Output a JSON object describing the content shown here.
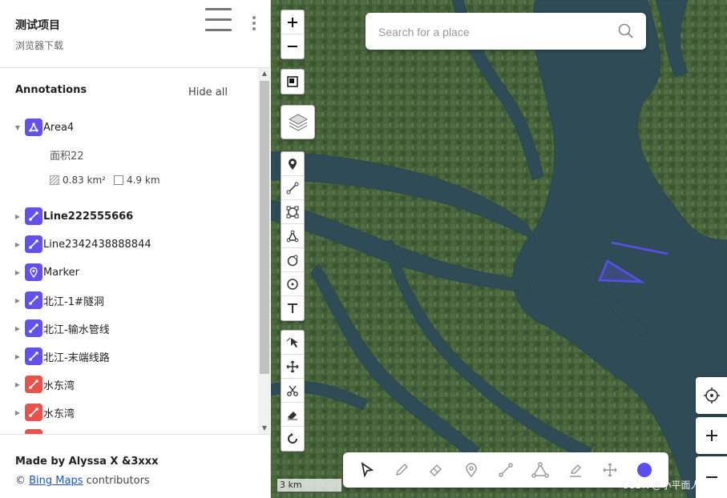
{
  "project": {
    "title": "测试项目",
    "subtitle": "浏览器下载"
  },
  "annotations": {
    "heading": "Annotations",
    "hide_all": "Hide all",
    "items": [
      {
        "label": "Area4",
        "icon": "area-icon",
        "color": "#6351ee",
        "expanded": true,
        "detail_name": "面积22",
        "area": "0.83 km²",
        "perimeter": "4.9 km"
      },
      {
        "label": "Line222555666",
        "icon": "line-icon",
        "color": "#6351ee",
        "bold": true
      },
      {
        "label": "Line2342438888844",
        "icon": "line-icon",
        "color": "#6351ee"
      },
      {
        "label": "Marker",
        "icon": "marker-icon",
        "color": "#6351ee"
      },
      {
        "label": "北江-1#隧洞",
        "icon": "line-icon",
        "color": "#6351ee"
      },
      {
        "label": "北江-输水管线",
        "icon": "line-icon",
        "color": "#6351ee"
      },
      {
        "label": "北江-末端线路",
        "icon": "line-icon",
        "color": "#6351ee"
      },
      {
        "label": "水东湾",
        "icon": "line-icon",
        "color": "#e9524a"
      },
      {
        "label": "水东湾",
        "icon": "line-icon",
        "color": "#e9524a"
      }
    ]
  },
  "footer": {
    "made_by": "Made by Alyssa X &3xxx",
    "copyright": "©",
    "link": "Bing Maps",
    "contributors": "contributors"
  },
  "map": {
    "search_placeholder": "Search for a place",
    "scale": "3 km",
    "watermark": "CSDN @小平面人",
    "drawn_shape_color": "#5b4ef0",
    "active_color": "#5b4ef0"
  },
  "map_tools_left": [
    "marker-icon",
    "polyline-icon",
    "rectangle-icon",
    "polygon-icon",
    "circle-rotate-icon",
    "circle-icon",
    "text-icon",
    "pointer-select-icon",
    "move-icon",
    "scissors-icon",
    "eraser-icon",
    "rotate-icon"
  ],
  "map_tools_bottom": [
    "cursor-icon",
    "pencil-icon",
    "eraser-icon",
    "marker-icon",
    "line-icon",
    "polygon-icon",
    "highlighter-icon",
    "move-icon",
    "color-picker"
  ]
}
